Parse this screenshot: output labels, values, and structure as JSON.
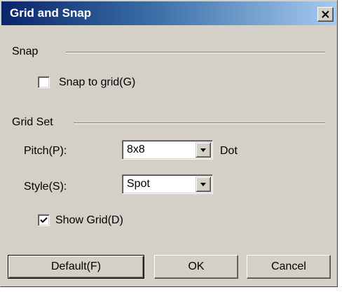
{
  "dialog": {
    "title": "Grid and Snap",
    "close_glyph": "✕"
  },
  "snap": {
    "group_label": "Snap",
    "snap_to_grid": {
      "label": "Snap to grid(G)",
      "checked": false
    }
  },
  "grid_set": {
    "group_label": "Grid Set",
    "pitch": {
      "label": "Pitch(P):",
      "value": "8x8",
      "unit": "Dot"
    },
    "style": {
      "label": "Style(S):",
      "value": "Spot"
    },
    "show_grid": {
      "label": "Show Grid(D)",
      "checked": true
    }
  },
  "buttons": {
    "default_label": "Default(F)",
    "ok_label": "OK",
    "cancel_label": "Cancel"
  },
  "colors": {
    "title_gradient_start": "#0a246a",
    "title_gradient_end": "#a6caf0",
    "face": "#d4d0c8"
  },
  "icons": {
    "close": "close-icon",
    "checkmark": "checkmark-icon",
    "dropdown": "chevron-down-icon"
  }
}
